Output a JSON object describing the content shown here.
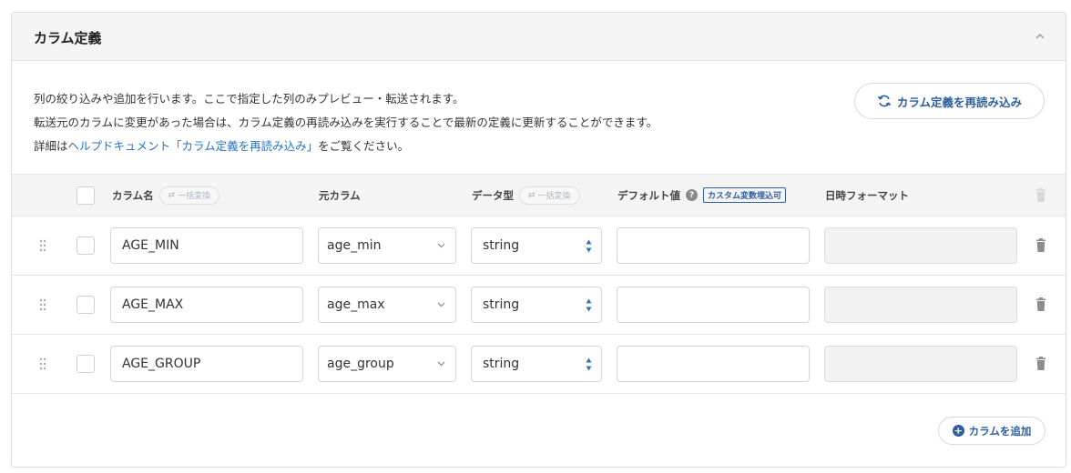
{
  "panel": {
    "title": "カラム定義"
  },
  "description": {
    "line1": "列の絞り込みや追加を行います。ここで指定した列のみプレビュー・転送されます。",
    "line2": "転送元のカラムに変更があった場合は、カラム定義の再読み込みを実行することで最新の定義に更新することができます。",
    "line3_prefix": "詳細は",
    "line3_link": "ヘルプドキュメント「カラム定義を再読み込み」",
    "line3_suffix": "をご覧ください。"
  },
  "reload_button": {
    "label": "カラム定義を再読み込み",
    "icon": "refresh-icon"
  },
  "columns": {
    "name": "カラム名",
    "source": "元カラム",
    "type": "データ型",
    "default": "デフォルト値",
    "default_badge": "カスタム変数埋込可",
    "datetime_format": "日時フォーマット",
    "bulk_convert": "一括変換"
  },
  "rows": [
    {
      "name": "AGE_MIN",
      "source": "age_min",
      "type": "string",
      "default": "",
      "datetime_format": ""
    },
    {
      "name": "AGE_MAX",
      "source": "age_max",
      "type": "string",
      "default": "",
      "datetime_format": ""
    },
    {
      "name": "AGE_GROUP",
      "source": "age_group",
      "type": "string",
      "default": "",
      "datetime_format": ""
    }
  ],
  "add_button": {
    "label": "カラムを追加",
    "icon": "plus-circle-icon"
  },
  "colors": {
    "accent": "#2f5f9c",
    "link": "#2a72c4",
    "header_bg": "#f4f4f4"
  }
}
